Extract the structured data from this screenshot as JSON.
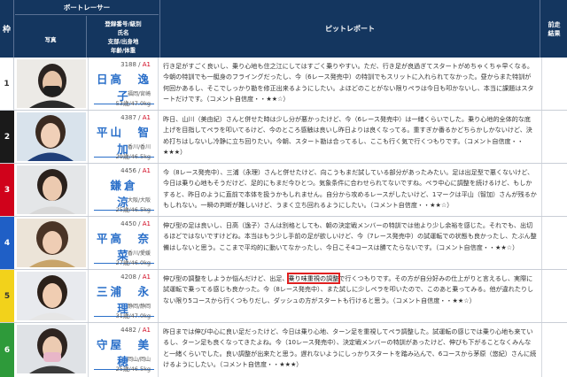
{
  "header": {
    "waku": "枠",
    "boat_racer": "ボートレーサー",
    "photo": "写真",
    "info_lines": [
      "登録番号/級別",
      "氏名",
      "支部/出身地",
      "年齢/体重"
    ],
    "pit_report": "ピットレポート",
    "prev_lines": [
      "前走",
      "結果"
    ]
  },
  "colors": {
    "header_bg": "#14365f",
    "waku_1": "#ffffff",
    "waku_2": "#1a1a1a",
    "waku_3": "#d0021b",
    "waku_4": "#1f5fc6",
    "waku_5": "#f2d21b",
    "waku_6": "#2e9a3a",
    "name_link": "#2a6fc9",
    "grade": "#d0021b",
    "highlight_box": "#e02020"
  },
  "racers": [
    {
      "waku": "1",
      "reg": "3188 / ",
      "grade": "A1",
      "name": "日高　逸子",
      "branch": "福岡/宮崎",
      "body": "53歳/47.0kg",
      "report": "行き足がすごく良いし、乗り心地も住之江にしてはすごく乗りやすい。ただ、行き足が良過ぎてスタートがめちゃくちゃ早くなる。今朝の特訓でも一艇身のフライングだったし、今（6レース発売中）の特訓でもスリットに入れられてなかった。昼からまた特訓が何回かあるし、そこでしっかり勘を修正出来るようにしたい。よほどのことがない限りペラは今日も叩かないし、本当に課題はスタートだけです。（コメント自信度・・★★☆）"
    },
    {
      "waku": "2",
      "reg": "4387 / ",
      "grade": "A1",
      "name": "平山　智加",
      "branch": "香川/香川",
      "body": "29歳/46.5kg",
      "report": "昨日、山川（美由紀）さんと併せた時は少し分が悪かったけど、今（6レース発売中）は一緒くらいでした。乗り心地的全体的な底上げを目指してペラを叩いてるけど、今のところ感触は良いし昨日よりは良くなってる。重すぎか番るかどちらかしかないけど、決め打ちはしないし冷静に立ち回りたい。今朝、スタート勘は合ってるし、ここも行く気で行くつもりです。（コメント自信度・・★★★）"
    },
    {
      "waku": "3",
      "reg": "4456 / ",
      "grade": "A1",
      "name": "鎌倉　　涼",
      "branch": "大阪/大阪",
      "body": "25歳/46.5kg",
      "report": "今（8レース発売中）、三浦（永理）さんと併せたけど、向こうもまだ試している部分があったみたい。足は出足型で悪くないけど、今日は乗り心地もそうだけど、足的にもまだ今ひとつ。気象条件に合わせられてないですね。ペラ中心に調整を続けるけど、もしかすると、昨日のように直前で本体を扱うかもしれません。自分から攻めるレースがしたいけど、1マークは平山（智加）さんが残るかもしれない。一瞬の判断が難しいけど、うまく立ち回れるようにしたい。（コメント自信度・・★★☆）"
    },
    {
      "waku": "4",
      "reg": "4450 / ",
      "grade": "A1",
      "name": "平高　奈菜",
      "branch": "香川/愛媛",
      "body": "27歳/46.0kg",
      "report": "伸び型の足は良いし、日高（逸子）さんは別格としても、朝の決定戦メンバーの特訓では他より少し余裕を感じた。それでも、出切るほどではないですけどね。本当はもう少し手前の足が欲しいけど、今（7レース発売中）の試運転での状態も良かったし、たぶん整備はしないと思う。ここまで平均的に動いてなかったし、今日こそ4コースは勝てたらないです。（コメント自信度・・★★☆）"
    },
    {
      "waku": "5",
      "reg": "4208 / ",
      "grade": "A1",
      "name": "三浦　永理",
      "branch": "静岡/静岡",
      "body": "31歳/47.0kg",
      "report_before": "伸び型の調整をしようか悩んだけど、出足、",
      "report_hl": "乗り味重視の調整",
      "report_after": "で行くつもりです。その方が自分好みの仕上がりと言えるし、実際に試運転で乗ってる感じも良かった。今（8レース発売中）、また試しに少しペラを叩いたので、このあと乗ってみる。他が違れたりしない限り5コースから行くつもりだし、ダッシュの方がスタートも行けると思う。（コメント自信度・・★★☆）"
    },
    {
      "waku": "6",
      "reg": "4482 / ",
      "grade": "A1",
      "name": "守屋　美穂",
      "branch": "岡山/岡山",
      "body": "25歳/46.5kg",
      "report": "昨日までは伸び中心に良い足だったけど、今日は乗り心地、ターン足を重視してペラ調整した。試運転の感じでは乗り心地も来ているし、ターン足も良くなってきたよね。今（10レース発売中）、決定戦メンバーの特訓があったけど、伸びも下がることなくみんなと一緒くらいでした。良い調整が出来たと思う。遅れないようにしっかりスタートを踏み込んで、6コースから茅原（悠紀）さんに続けるようにしたい。（コメント自信度・・★★★）"
    }
  ]
}
